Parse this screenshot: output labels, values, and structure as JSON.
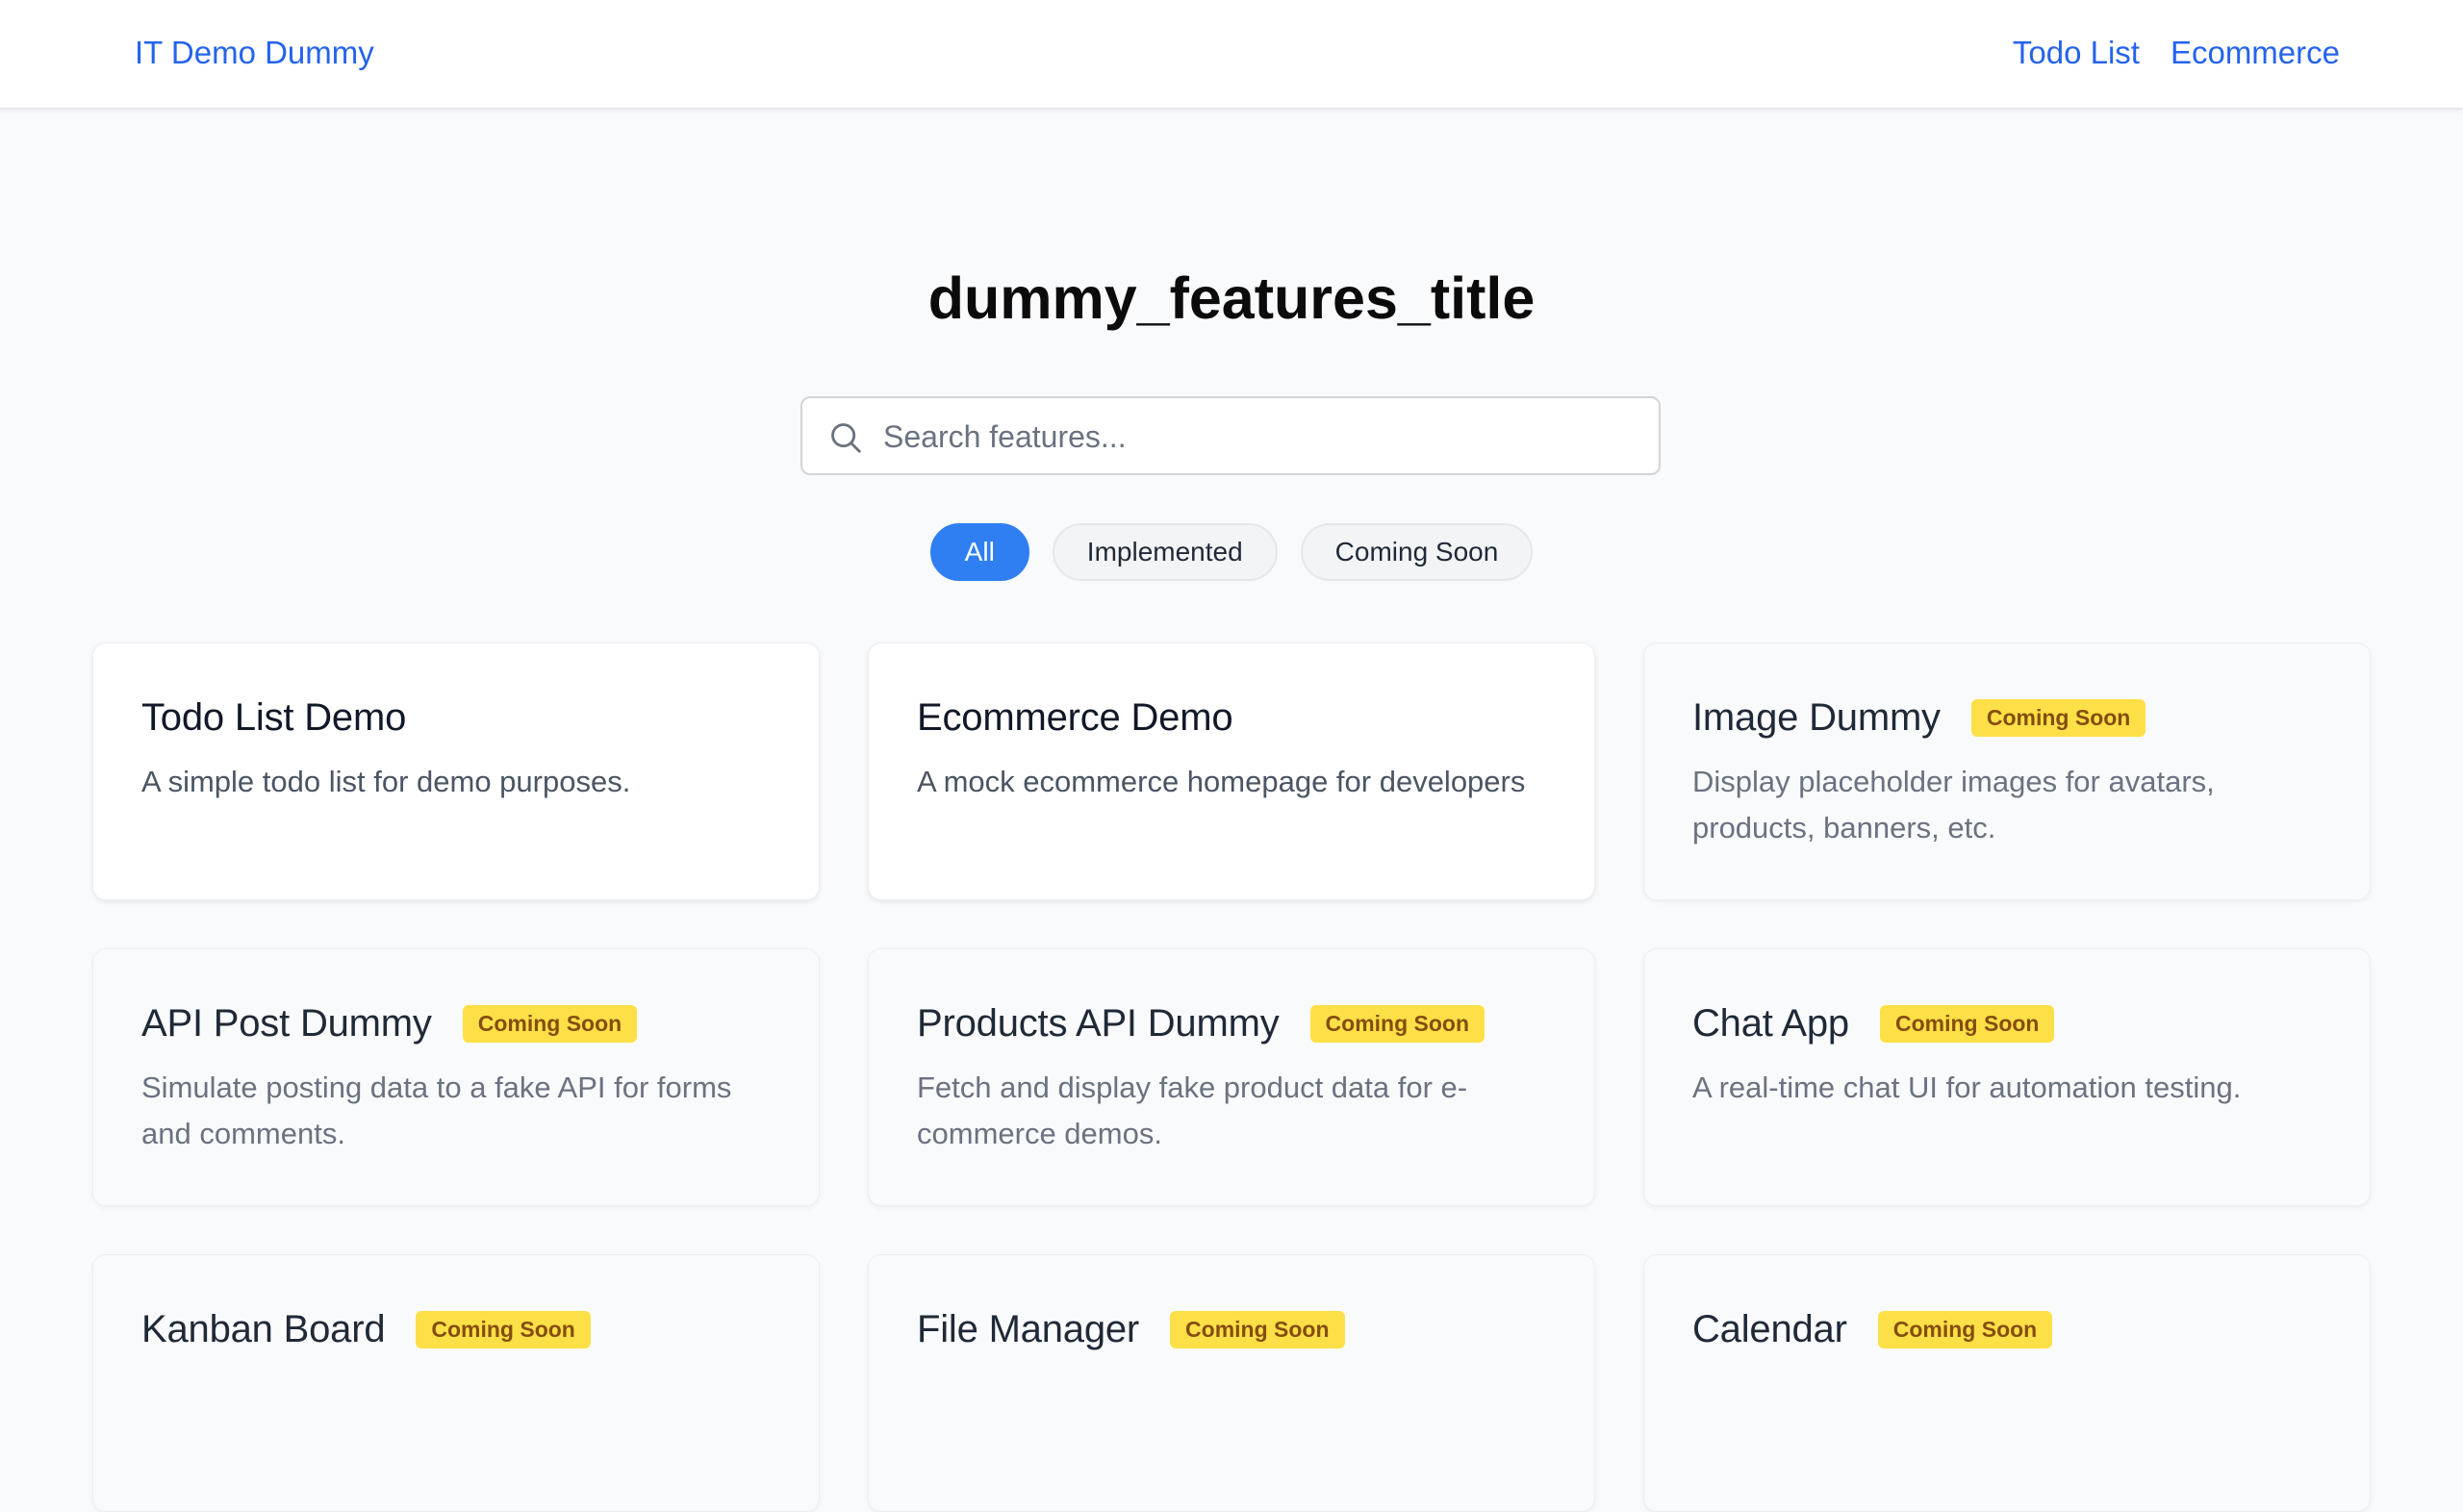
{
  "header": {
    "brand": "IT Demo Dummy",
    "nav": [
      "Todo List",
      "Ecommerce"
    ]
  },
  "page": {
    "title": "dummy_features_title"
  },
  "search": {
    "placeholder": "Search features..."
  },
  "filters": {
    "all": "All",
    "implemented": "Implemented",
    "coming_soon": "Coming Soon",
    "selected": "All"
  },
  "features": [
    {
      "title": "Todo List Demo",
      "desc": "A simple todo list for demo purposes.",
      "badge": ""
    },
    {
      "title": "Ecommerce Demo",
      "desc": "A mock ecommerce homepage for developers",
      "badge": ""
    },
    {
      "title": "Image Dummy",
      "desc": "Display placeholder images for avatars, products, banners, etc.",
      "badge": "Coming Soon"
    },
    {
      "title": "API Post Dummy",
      "desc": "Simulate posting data to a fake API for forms and comments.",
      "badge": "Coming Soon"
    },
    {
      "title": "Products API Dummy",
      "desc": "Fetch and display fake product data for e-commerce demos.",
      "badge": "Coming Soon"
    },
    {
      "title": "Chat App",
      "desc": "A real-time chat UI for automation testing.",
      "badge": "Coming Soon"
    },
    {
      "title": "Kanban Board",
      "desc": "",
      "badge": "Coming Soon"
    },
    {
      "title": "File Manager",
      "desc": "",
      "badge": "Coming Soon"
    },
    {
      "title": "Calendar",
      "desc": "",
      "badge": "Coming Soon"
    }
  ],
  "colors": {
    "accent": "#2563eb",
    "badge_bg": "#fde047",
    "badge_text": "#854d0e"
  },
  "icons": {
    "search": "search-icon"
  }
}
